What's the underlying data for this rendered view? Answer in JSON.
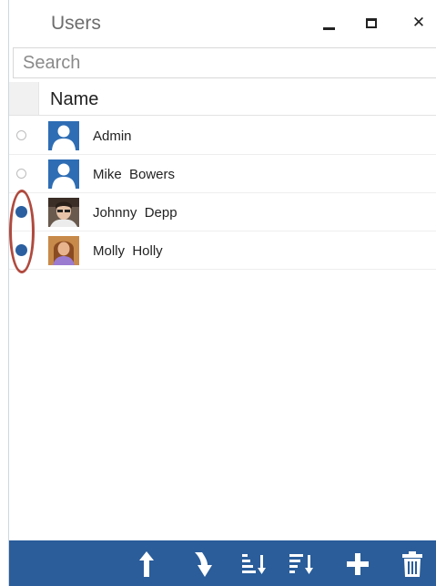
{
  "window": {
    "title": "Users"
  },
  "titlebar": {
    "minimize_icon": "minimize-icon",
    "maximize_icon": "maximize-icon",
    "close_icon": "close-icon",
    "close_glyph": "✕"
  },
  "search": {
    "placeholder": "Search",
    "value": ""
  },
  "grid": {
    "column_name": "Name"
  },
  "users": [
    {
      "name": "Admin",
      "selected": false,
      "avatar": "default-user-icon"
    },
    {
      "name": "Mike  Bowers",
      "selected": false,
      "avatar": "default-user-icon"
    },
    {
      "name": "Johnny  Depp",
      "selected": true,
      "avatar": "user-photo"
    },
    {
      "name": "Molly  Holly",
      "selected": true,
      "avatar": "user-photo"
    }
  ],
  "toolbar": {
    "buttons": [
      "move-up-icon",
      "move-down-icon",
      "sort-ascending-icon",
      "sort-descending-icon",
      "add-icon",
      "delete-icon"
    ]
  },
  "colors": {
    "toolbar": "#2a5d9a",
    "radio_selected": "#2b5fa0",
    "annotation": "#b04a3e",
    "avatar_default": "#2e6db4"
  }
}
